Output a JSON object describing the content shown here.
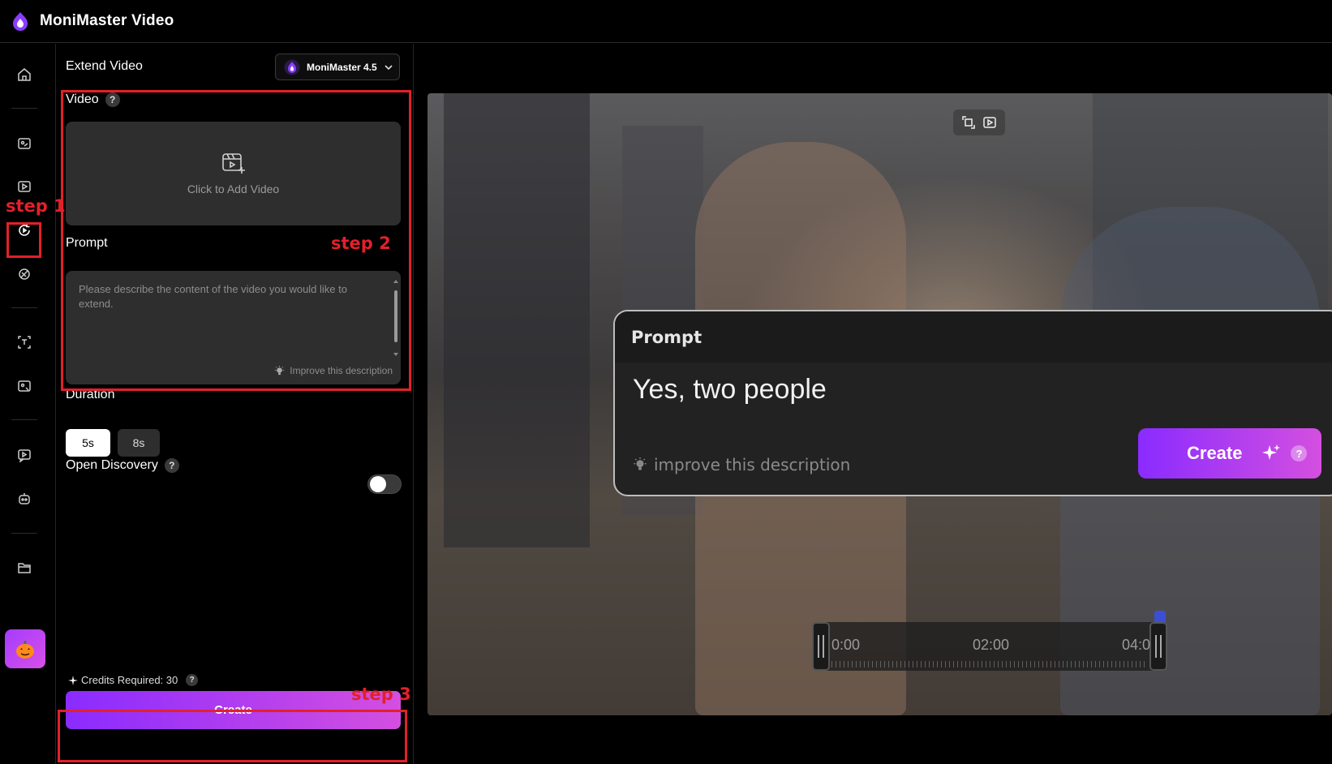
{
  "app": {
    "title": "MoniMaster Video"
  },
  "panel": {
    "title": "Extend Video",
    "model_label": "MoniMaster 4.5",
    "video_label": "Video",
    "upload_text": "Click to Add Video",
    "prompt_label": "Prompt",
    "prompt_placeholder": "Please describe the content of the video you would like to extend.",
    "improve_label": "Improve this description",
    "duration_label": "Duration",
    "duration_options": [
      "5s",
      "8s"
    ],
    "duration_selected": "5s",
    "open_discovery_label": "Open Discovery",
    "credits_label": "Credits Required: 30",
    "create_label": "Create",
    "help_glyph": "?"
  },
  "annotations": {
    "step1": "step 1",
    "step2": "step 2",
    "step3": "step 3"
  },
  "preview": {
    "prompt_card": {
      "title": "Prompt",
      "text": "Yes, two people",
      "improve_label": "improve this description",
      "create_label": "Create",
      "help_glyph": "?"
    },
    "timeline": {
      "labels": [
        "0:00",
        "02:00",
        "04:0"
      ]
    }
  },
  "icons": {
    "sidebar": [
      "home-icon",
      "image-video-icon",
      "text-video-icon",
      "extend-video-icon",
      "effects-icon",
      "scan-text-icon",
      "photo-edit-icon",
      "chat-video-icon",
      "robot-icon",
      "folder-icon",
      "pumpkin-icon"
    ]
  },
  "colors": {
    "accent_start": "#8a2bff",
    "accent_end": "#d44fe0",
    "annotation": "#e3202a"
  }
}
